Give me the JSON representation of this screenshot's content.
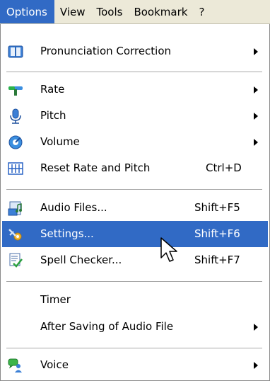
{
  "menubar": {
    "items": [
      {
        "label": "Options",
        "active": true
      },
      {
        "label": "View"
      },
      {
        "label": "Tools"
      },
      {
        "label": "Bookmark"
      },
      {
        "label": "?"
      }
    ]
  },
  "menu": {
    "items": [
      {
        "label": "Pronunciation Correction",
        "icon": "book-icon",
        "submenu": true
      },
      {
        "label": "Rate",
        "icon": "rate-icon",
        "submenu": true
      },
      {
        "label": "Pitch",
        "icon": "microphone-icon",
        "submenu": true
      },
      {
        "label": "Volume",
        "icon": "volume-icon",
        "submenu": true
      },
      {
        "label": "Reset Rate and Pitch",
        "icon": "reset-icon",
        "shortcut": "Ctrl+D"
      },
      {
        "label": "Audio Files...",
        "icon": "audio-files-icon",
        "shortcut": "Shift+F5"
      },
      {
        "label": "Settings...",
        "icon": "settings-icon",
        "shortcut": "Shift+F6",
        "highlighted": true
      },
      {
        "label": "Spell Checker...",
        "icon": "spell-checker-icon",
        "shortcut": "Shift+F7"
      },
      {
        "label": "Timer"
      },
      {
        "label": "After Saving of Audio File",
        "submenu": true
      },
      {
        "label": "Voice",
        "icon": "voice-icon",
        "submenu": true
      }
    ]
  },
  "colors": {
    "highlight": "#316ac5",
    "menubar_bg": "#ece9d8"
  }
}
